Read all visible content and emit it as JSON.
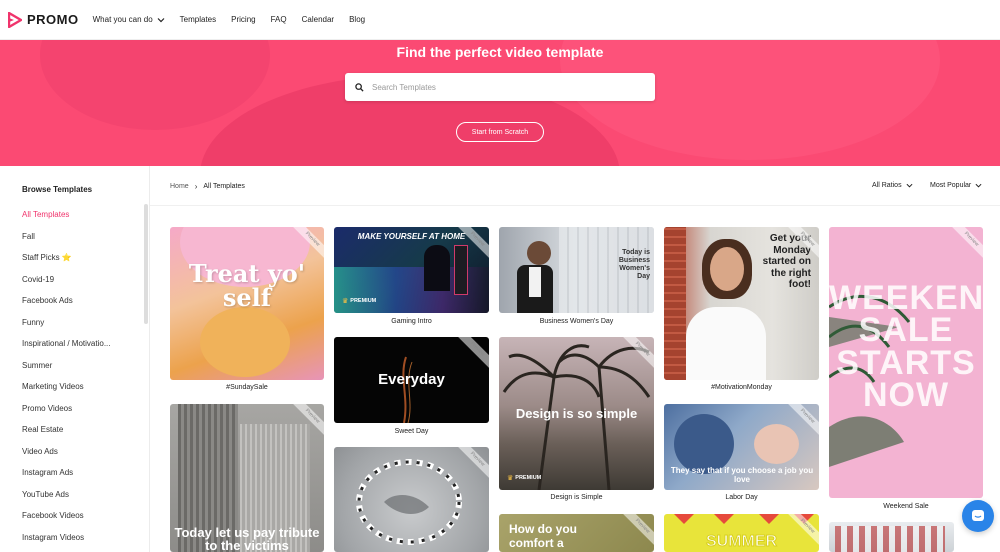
{
  "brand": {
    "name": "PROMO",
    "color": "#f0346c"
  },
  "nav": {
    "items": [
      {
        "label": "What you can do",
        "dropdown": true
      },
      {
        "label": "Templates"
      },
      {
        "label": "Pricing"
      },
      {
        "label": "FAQ"
      },
      {
        "label": "Calendar"
      },
      {
        "label": "Blog"
      }
    ]
  },
  "hero": {
    "title": "Find the perfect video template",
    "search_placeholder": "Search Templates",
    "search_icon": "search-icon",
    "scratch_button": "Start from Scratch",
    "bg_color": "#fb4a73"
  },
  "sidebar": {
    "title": "Browse Templates",
    "items": [
      {
        "label": "All Templates",
        "active": true
      },
      {
        "label": "Fall"
      },
      {
        "label": "Staff Picks ⭐"
      },
      {
        "label": "Covid-19"
      },
      {
        "label": "Facebook Ads"
      },
      {
        "label": "Funny"
      },
      {
        "label": "Inspirational / Motivatio..."
      },
      {
        "label": "Summer"
      },
      {
        "label": "Marketing Videos"
      },
      {
        "label": "Promo Videos"
      },
      {
        "label": "Real Estate"
      },
      {
        "label": "Video Ads"
      },
      {
        "label": "Instagram Ads"
      },
      {
        "label": "YouTube Ads"
      },
      {
        "label": "Facebook Videos"
      },
      {
        "label": "Instagram Videos"
      }
    ]
  },
  "breadcrumb": {
    "home": "Home",
    "current": "All Templates"
  },
  "sort": {
    "ratios": "All Ratios",
    "order": "Most Popular"
  },
  "templates": [
    {
      "caption": "#SundaySale",
      "overlay": "Treat yo' self"
    },
    {
      "caption": "Gaming Intro",
      "overlay": "MAKE YOURSELF AT HOME",
      "premium": "PREMIUM"
    },
    {
      "caption": "Sweet Day",
      "overlay": "Everyday"
    },
    {
      "caption": "Business Women's Day",
      "overlay": "Today is Business Women's Day"
    },
    {
      "caption": "Design is Simple",
      "overlay": "Design is so simple",
      "premium": "PREMIUM"
    },
    {
      "caption": "#MotivationMonday",
      "overlay": "Get your Monday started on the right foot!"
    },
    {
      "caption": "Labor Day",
      "overlay": "They say that if you choose a job you love"
    },
    {
      "caption": "Weekend Sale",
      "overlay": "WEEKEND SALE STARTS NOW"
    },
    {
      "caption": "",
      "overlay": "Today let us pay tribute to the victims"
    },
    {
      "caption": "",
      "overlay": "How do you comfort a"
    },
    {
      "caption": "",
      "overlay": "SUMMER"
    }
  ],
  "ribbon_label": "Preview"
}
